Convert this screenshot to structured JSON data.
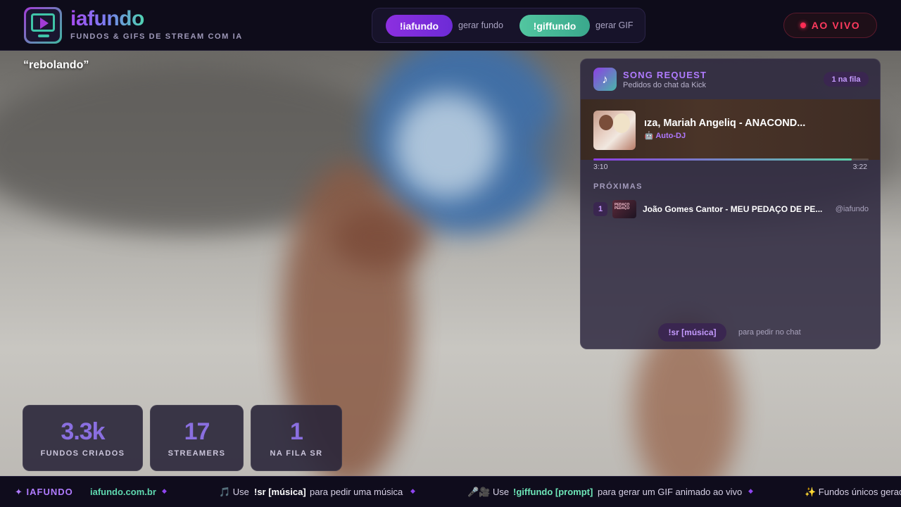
{
  "header": {
    "brand": "iafundo",
    "tagline": "FUNDOS & GIFS DE STREAM COM IA",
    "commands": [
      {
        "label": "!iafundo",
        "desc": "gerar fundo"
      },
      {
        "label": "!giffundo",
        "desc": "gerar GIF"
      }
    ],
    "live_label": "AO VIVO",
    "icons": {
      "logo": "monitor-play-icon",
      "live": "live-dot-icon"
    }
  },
  "background_prompt": "“rebolando”",
  "song_request": {
    "title": "SONG REQUEST",
    "subtitle": "Pedidos do chat da Kick",
    "queue_badge": "1 na fila",
    "icon": "music-note-icon",
    "now_playing": {
      "title": "ıza, Mariah Angeliq - ANACOND...",
      "requester": "🤖 Auto-DJ",
      "current_time": "3:10",
      "total_time": "3:22",
      "progress": 0.938
    },
    "next_header": "PRÓXIMAS",
    "queue": [
      {
        "position": "1",
        "title": "João Gomes Cantor - MEU PEDAÇO DE PE...",
        "user": "@iafundo",
        "thumb_text": "PEDAÇO PEDAÇO"
      }
    ],
    "command": "!sr [música]",
    "command_hint": "para pedir no chat"
  },
  "stats": [
    {
      "value": "3.3k",
      "label": "FUNDOS CRIADOS"
    },
    {
      "value": "17",
      "label": "STREAMERS"
    },
    {
      "value": "1",
      "label": "NA FILA SR"
    }
  ],
  "ticker": {
    "brand": "✦ IAFUNDO",
    "site": "iafundo.com.br",
    "item1_prefix": "🎵 Use",
    "item1_cmd": "!sr [música]",
    "item1_suffix": "para pedir uma música",
    "item2_prefix": "🎤🎥 Use",
    "item2_cmd": "!giffundo [prompt]",
    "item2_suffix": "para gerar um GIF animado ao vivo",
    "item3": "✨ Fundos únicos gerad"
  },
  "colors": {
    "accent_purple": "#8d3fe4",
    "accent_green": "#52c6a0",
    "live_red": "#ff2d55",
    "panel_bg": "#28223a"
  }
}
